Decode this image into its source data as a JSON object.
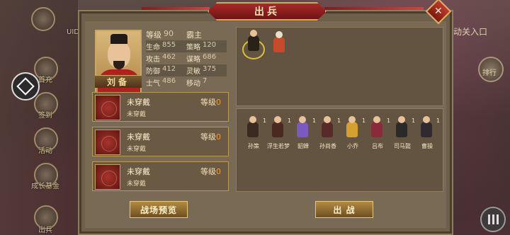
{
  "window": {
    "title": "出兵"
  },
  "hero": {
    "name": "刘备",
    "level_label": "等级",
    "level_value": "90",
    "title": "霸主",
    "stats": [
      {
        "k1": "生命",
        "v1": "855",
        "k2": "策略",
        "v2": "120"
      },
      {
        "k1": "攻击",
        "v1": "462",
        "k2": "谋略",
        "v2": "686"
      },
      {
        "k1": "防御",
        "v1": "412",
        "k2": "灵敏",
        "v2": "375"
      },
      {
        "k1": "士气",
        "v1": "486",
        "k2": "移动",
        "v2": "7"
      }
    ]
  },
  "equipment": [
    {
      "name": "未穿戴",
      "level_label": "等级",
      "level_value": "0",
      "sub": "未穿戴"
    },
    {
      "name": "未穿戴",
      "level_label": "等级",
      "level_value": "0",
      "sub": "未穿戴"
    },
    {
      "name": "未穿戴",
      "level_label": "等级",
      "level_value": "0",
      "sub": "未穿戴"
    }
  ],
  "roster": [
    {
      "name": "孙策",
      "count": "1",
      "color": "#3a2a22"
    },
    {
      "name": "浮生若梦",
      "count": "1",
      "color": "#4a2a20"
    },
    {
      "name": "貂蝉",
      "count": "1",
      "color": "#7a5ac0"
    },
    {
      "name": "孙尚香",
      "count": "1",
      "color": "#5a2a2a"
    },
    {
      "name": "小乔",
      "count": "1",
      "color": "#d6a030"
    },
    {
      "name": "吕布",
      "count": "1",
      "color": "#8a2a3a"
    },
    {
      "name": "司马懿",
      "count": "1",
      "color": "#2a2a2a"
    },
    {
      "name": "曹操",
      "count": "1",
      "color": "#2e2a30"
    }
  ],
  "buttons": {
    "preview": "战场预览",
    "deploy": "出 战"
  },
  "background": {
    "right_text": "动关入口",
    "right_btn": "排行",
    "left_labels": [
      "UID",
      "首充",
      "签到",
      "活动",
      "成长基金",
      "出兵"
    ]
  }
}
